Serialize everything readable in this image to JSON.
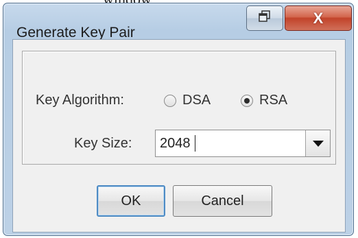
{
  "background": {
    "partial_text": "window"
  },
  "window": {
    "title": "Generate Key Pair",
    "restore_icon": "restore-icon",
    "close_icon": "close-icon",
    "close_glyph": "X"
  },
  "form": {
    "algorithm_label": "Key Algorithm:",
    "algorithm_options": [
      {
        "label": "DSA",
        "selected": false
      },
      {
        "label": "RSA",
        "selected": true
      }
    ],
    "key_size_label": "Key Size:",
    "key_size_value": "2048"
  },
  "buttons": {
    "ok_label": "OK",
    "cancel_label": "Cancel"
  },
  "colors": {
    "title_bar": "#bcd1e6",
    "close_button": "#c2432a",
    "default_button_border": "#4e8bc4"
  }
}
